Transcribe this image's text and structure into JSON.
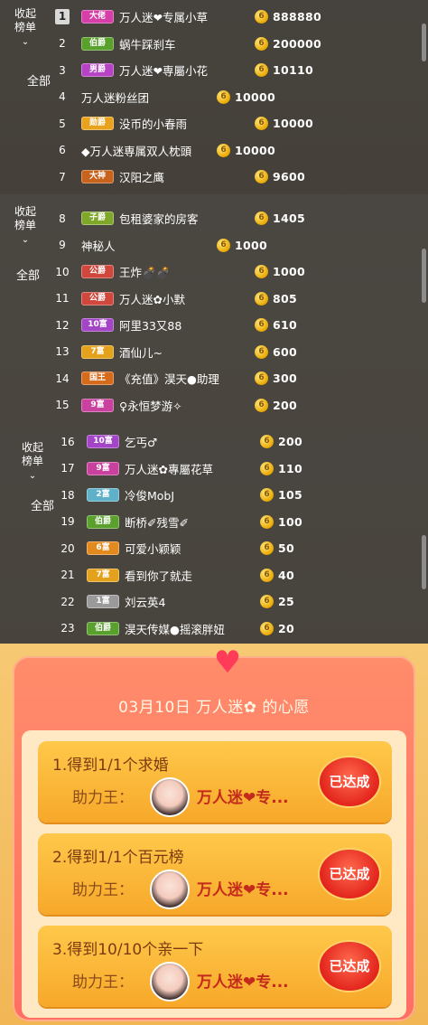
{
  "panel_labels": {
    "collapse_line1": "收起",
    "collapse_line2": "榜单",
    "tab_all": "全部"
  },
  "ranking": [
    {
      "rank": "1",
      "badge": "大佬",
      "badge_color": "#d63ea8",
      "name": "万人迷❤专属小草",
      "score": "888880"
    },
    {
      "rank": "2",
      "badge": "伯爵",
      "badge_color": "#5aa02c",
      "name": "蜗牛踩刹车",
      "score": "200000"
    },
    {
      "rank": "3",
      "badge": "男爵",
      "badge_color": "#b642c6",
      "name": "万人迷❤専屬小花",
      "score": "10110"
    },
    {
      "rank": "4",
      "badge": "",
      "badge_color": "",
      "name": "万人迷粉丝团",
      "score": "10000"
    },
    {
      "rank": "5",
      "badge": "勋爵",
      "badge_color": "#e8a21e",
      "name": "没币的小春雨",
      "score": "10000"
    },
    {
      "rank": "6",
      "badge": "",
      "badge_color": "",
      "name": "◆万人迷専属双人枕頭",
      "score": "10000"
    },
    {
      "rank": "7",
      "badge": "大神",
      "badge_color": "#c7631c",
      "name": "汉阳之鹰",
      "score": "9600"
    },
    {
      "rank": "8",
      "badge": "子爵",
      "badge_color": "#7fa82a",
      "name": "包租婆家的房客",
      "score": "1405"
    },
    {
      "rank": "9",
      "badge": "",
      "badge_color": "",
      "name": "神秘人",
      "score": "1000"
    },
    {
      "rank": "10",
      "badge": "公爵",
      "badge_color": "#d0473d",
      "name": "王炸💣💣",
      "score": "1000"
    },
    {
      "rank": "11",
      "badge": "公爵",
      "badge_color": "#d0473d",
      "name": "万人迷✿小默",
      "score": "805"
    },
    {
      "rank": "12",
      "badge": "10富",
      "badge_color": "#a445c7",
      "name": "阿里33又88",
      "score": "610"
    },
    {
      "rank": "13",
      "badge": "7富",
      "badge_color": "#e4a21c",
      "name": "酒仙儿~",
      "score": "600"
    },
    {
      "rank": "14",
      "badge": "国王",
      "badge_color": "#d66b1c",
      "name": "《充值》淏天●助理",
      "score": "300"
    },
    {
      "rank": "15",
      "badge": "9富",
      "badge_color": "#c9419e",
      "name": "♀永恒梦游✧",
      "score": "200"
    },
    {
      "rank": "16",
      "badge": "10富",
      "badge_color": "#a445c7",
      "name": "乞丐♂",
      "score": "200"
    },
    {
      "rank": "17",
      "badge": "9富",
      "badge_color": "#c9419e",
      "name": "万人迷✿專屬花草",
      "score": "110"
    },
    {
      "rank": "18",
      "badge": "2富",
      "badge_color": "#5fb1c9",
      "name": "冷俊MobJ",
      "score": "105"
    },
    {
      "rank": "19",
      "badge": "伯爵",
      "badge_color": "#5aa02c",
      "name": "断桥✐残雪✐",
      "score": "100"
    },
    {
      "rank": "20",
      "badge": "6富",
      "badge_color": "#e38a1e",
      "name": "可爱小颖颖",
      "score": "50"
    },
    {
      "rank": "21",
      "badge": "7富",
      "badge_color": "#e4a21c",
      "name": "看到你了就走",
      "score": "40"
    },
    {
      "rank": "22",
      "badge": "1富",
      "badge_color": "#9a9a9a",
      "name": "刘云英4",
      "score": "25"
    },
    {
      "rank": "23",
      "badge": "伯爵",
      "badge_color": "#5aa02c",
      "name": "淏天传媒●摇滚胖妞",
      "score": "20"
    }
  ],
  "wish": {
    "title": "03月10日 万人迷✿ 的心愿",
    "helper_label": "助力王：",
    "helper_name": "万人迷❤专...",
    "status": "已达成",
    "tasks": [
      {
        "text": "1.得到1/1个求婚"
      },
      {
        "text": "2.得到1/1个百元榜"
      },
      {
        "text": "3.得到10/10个亲一下"
      }
    ]
  }
}
